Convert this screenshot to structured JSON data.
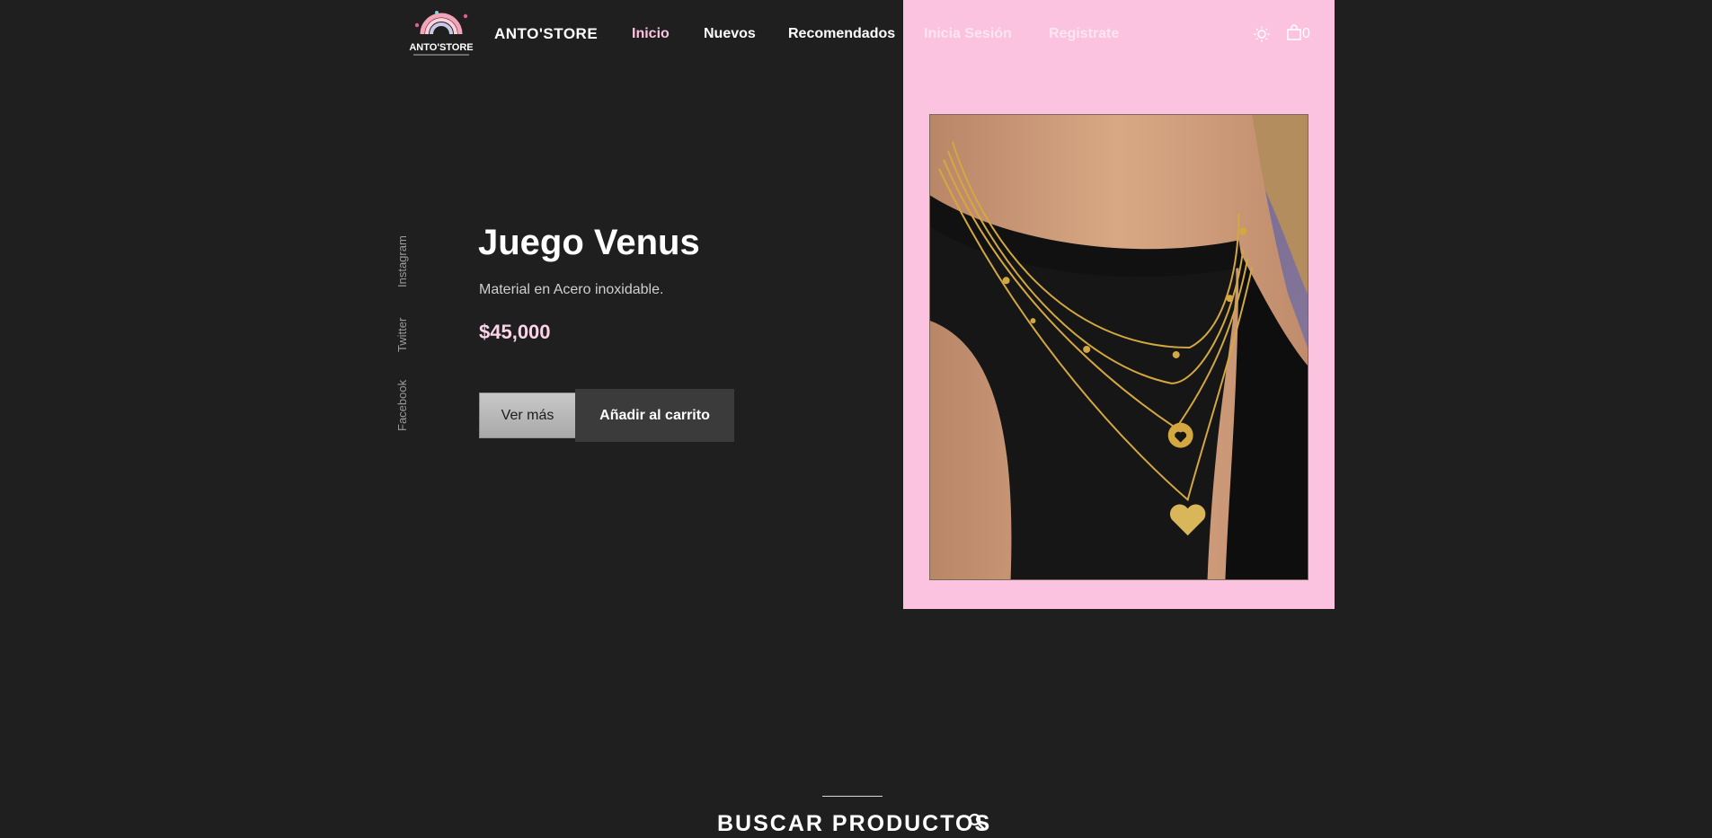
{
  "header": {
    "logo_text": "ANTO'STORE",
    "brand": "ANTO'STORE",
    "nav": [
      {
        "label": "Inicio"
      },
      {
        "label": "Nuevos"
      },
      {
        "label": "Recomendados"
      },
      {
        "label": "Inicia Sesión"
      },
      {
        "label": "Registrate"
      }
    ],
    "theme_icon": "sun-icon",
    "cart_icon": "shopping-bag-icon",
    "cart_count": "0"
  },
  "social": [
    {
      "label": "Instagram"
    },
    {
      "label": "Twitter"
    },
    {
      "label": "Facebook"
    }
  ],
  "hero": {
    "title": "Juego Venus",
    "description": "Material en Acero inoxidable.",
    "price": "$45,000",
    "view_more_label": "Ver más",
    "add_to_cart_label": "Añadir al carrito"
  },
  "search": {
    "title": "BUSCAR PRODUCTOS",
    "icon": "search-icon"
  },
  "colors": {
    "background": "#1f1f1f",
    "accent_pink": "#fcc3e0",
    "button_dark": "#3b3b3b"
  }
}
